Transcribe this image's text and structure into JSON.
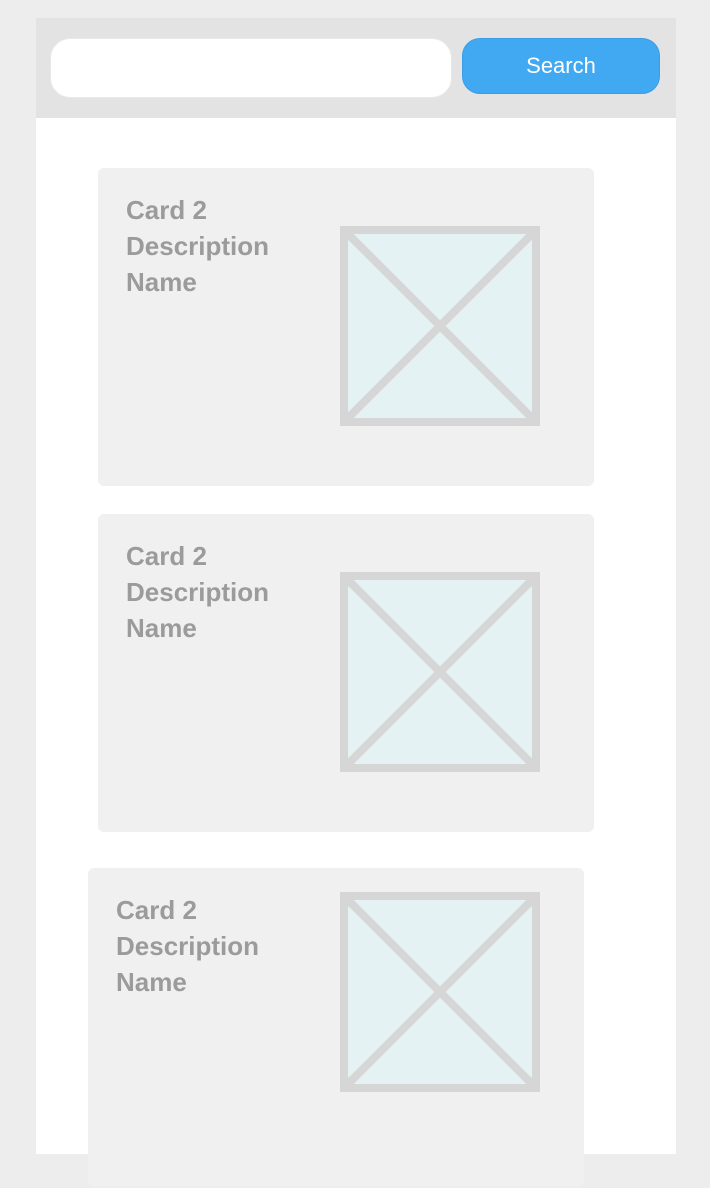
{
  "search": {
    "value": "",
    "placeholder": "",
    "button_label": "Search"
  },
  "cards": [
    {
      "title": "Card 2",
      "description": "Description",
      "name": "Name",
      "image_icon": "image-placeholder-icon"
    },
    {
      "title": "Card 2",
      "description": "Description",
      "name": "Name",
      "image_icon": "image-placeholder-icon"
    },
    {
      "title": "Card 2",
      "description": "Description",
      "name": "Name",
      "image_icon": "image-placeholder-icon"
    }
  ],
  "colors": {
    "accent": "#41a8f2",
    "page_background": "#ededed",
    "card_background": "#f0f0f0",
    "card_text": "#9b9b9b",
    "placeholder_fill": "#e4f2f4",
    "placeholder_stroke": "#d6d6d6"
  }
}
